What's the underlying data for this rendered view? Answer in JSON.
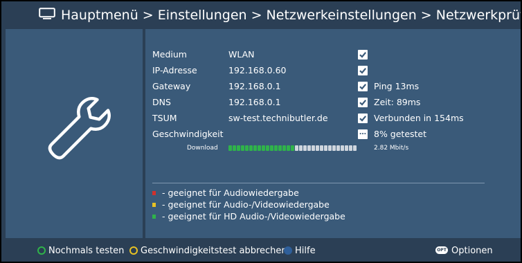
{
  "header": {
    "icon": "tv-icon",
    "breadcrumb": "Hauptmenü > Einstellungen > Netzwerkeinstellungen > Netzwerkprüfung"
  },
  "left_panel": {
    "icon": "wrench-icon"
  },
  "rows": [
    {
      "label": "Medium",
      "value": "WLAN",
      "status_icon": "checkmark-icon",
      "status": ""
    },
    {
      "label": "IP-Adresse",
      "value": "192.168.0.60",
      "status_icon": "checkmark-icon",
      "status": ""
    },
    {
      "label": "Gateway",
      "value": "192.168.0.1",
      "status_icon": "checkmark-icon",
      "status": "Ping 13ms"
    },
    {
      "label": "DNS",
      "value": "192.168.0.1",
      "status_icon": "checkmark-icon",
      "status": "Zeit: 89ms"
    },
    {
      "label": "TSUM",
      "value": "sw-test.technibutler.de",
      "status_icon": "checkmark-icon",
      "status": "Verbunden in 154ms"
    },
    {
      "label": "Geschwindigkeit",
      "value": "",
      "status_icon": "progress-dots-icon",
      "status": "8% getestet"
    }
  ],
  "download": {
    "label": "Download",
    "speed": "2.82 Mbit/s",
    "segments_total": 31,
    "segments_filled": 16,
    "filled_color": "#2fb34a",
    "empty_color": "#cfd6de"
  },
  "legend": [
    {
      "color": "#d0312d",
      "text": "- geeignet für Audiowiedergabe"
    },
    {
      "color": "#e8c224",
      "text": "- geeignet für Audio-/Videowiedergabe"
    },
    {
      "color": "#2fb34a",
      "text": "- geeignet für HD Audio-/Videowiedergabe"
    }
  ],
  "footer": {
    "green_label": "Nochmals testen",
    "yellow_label": "Geschwindigkeitstest abbrechen",
    "blue_label": "Hilfe",
    "opt_badge": "OPT",
    "options_label": "Optionen"
  },
  "colors": {
    "background": "#2b3f55",
    "panel": "#3a5a79",
    "green_button": "#2fb34a",
    "yellow_button": "#e8c224",
    "blue_button": "#2f5f9a"
  }
}
